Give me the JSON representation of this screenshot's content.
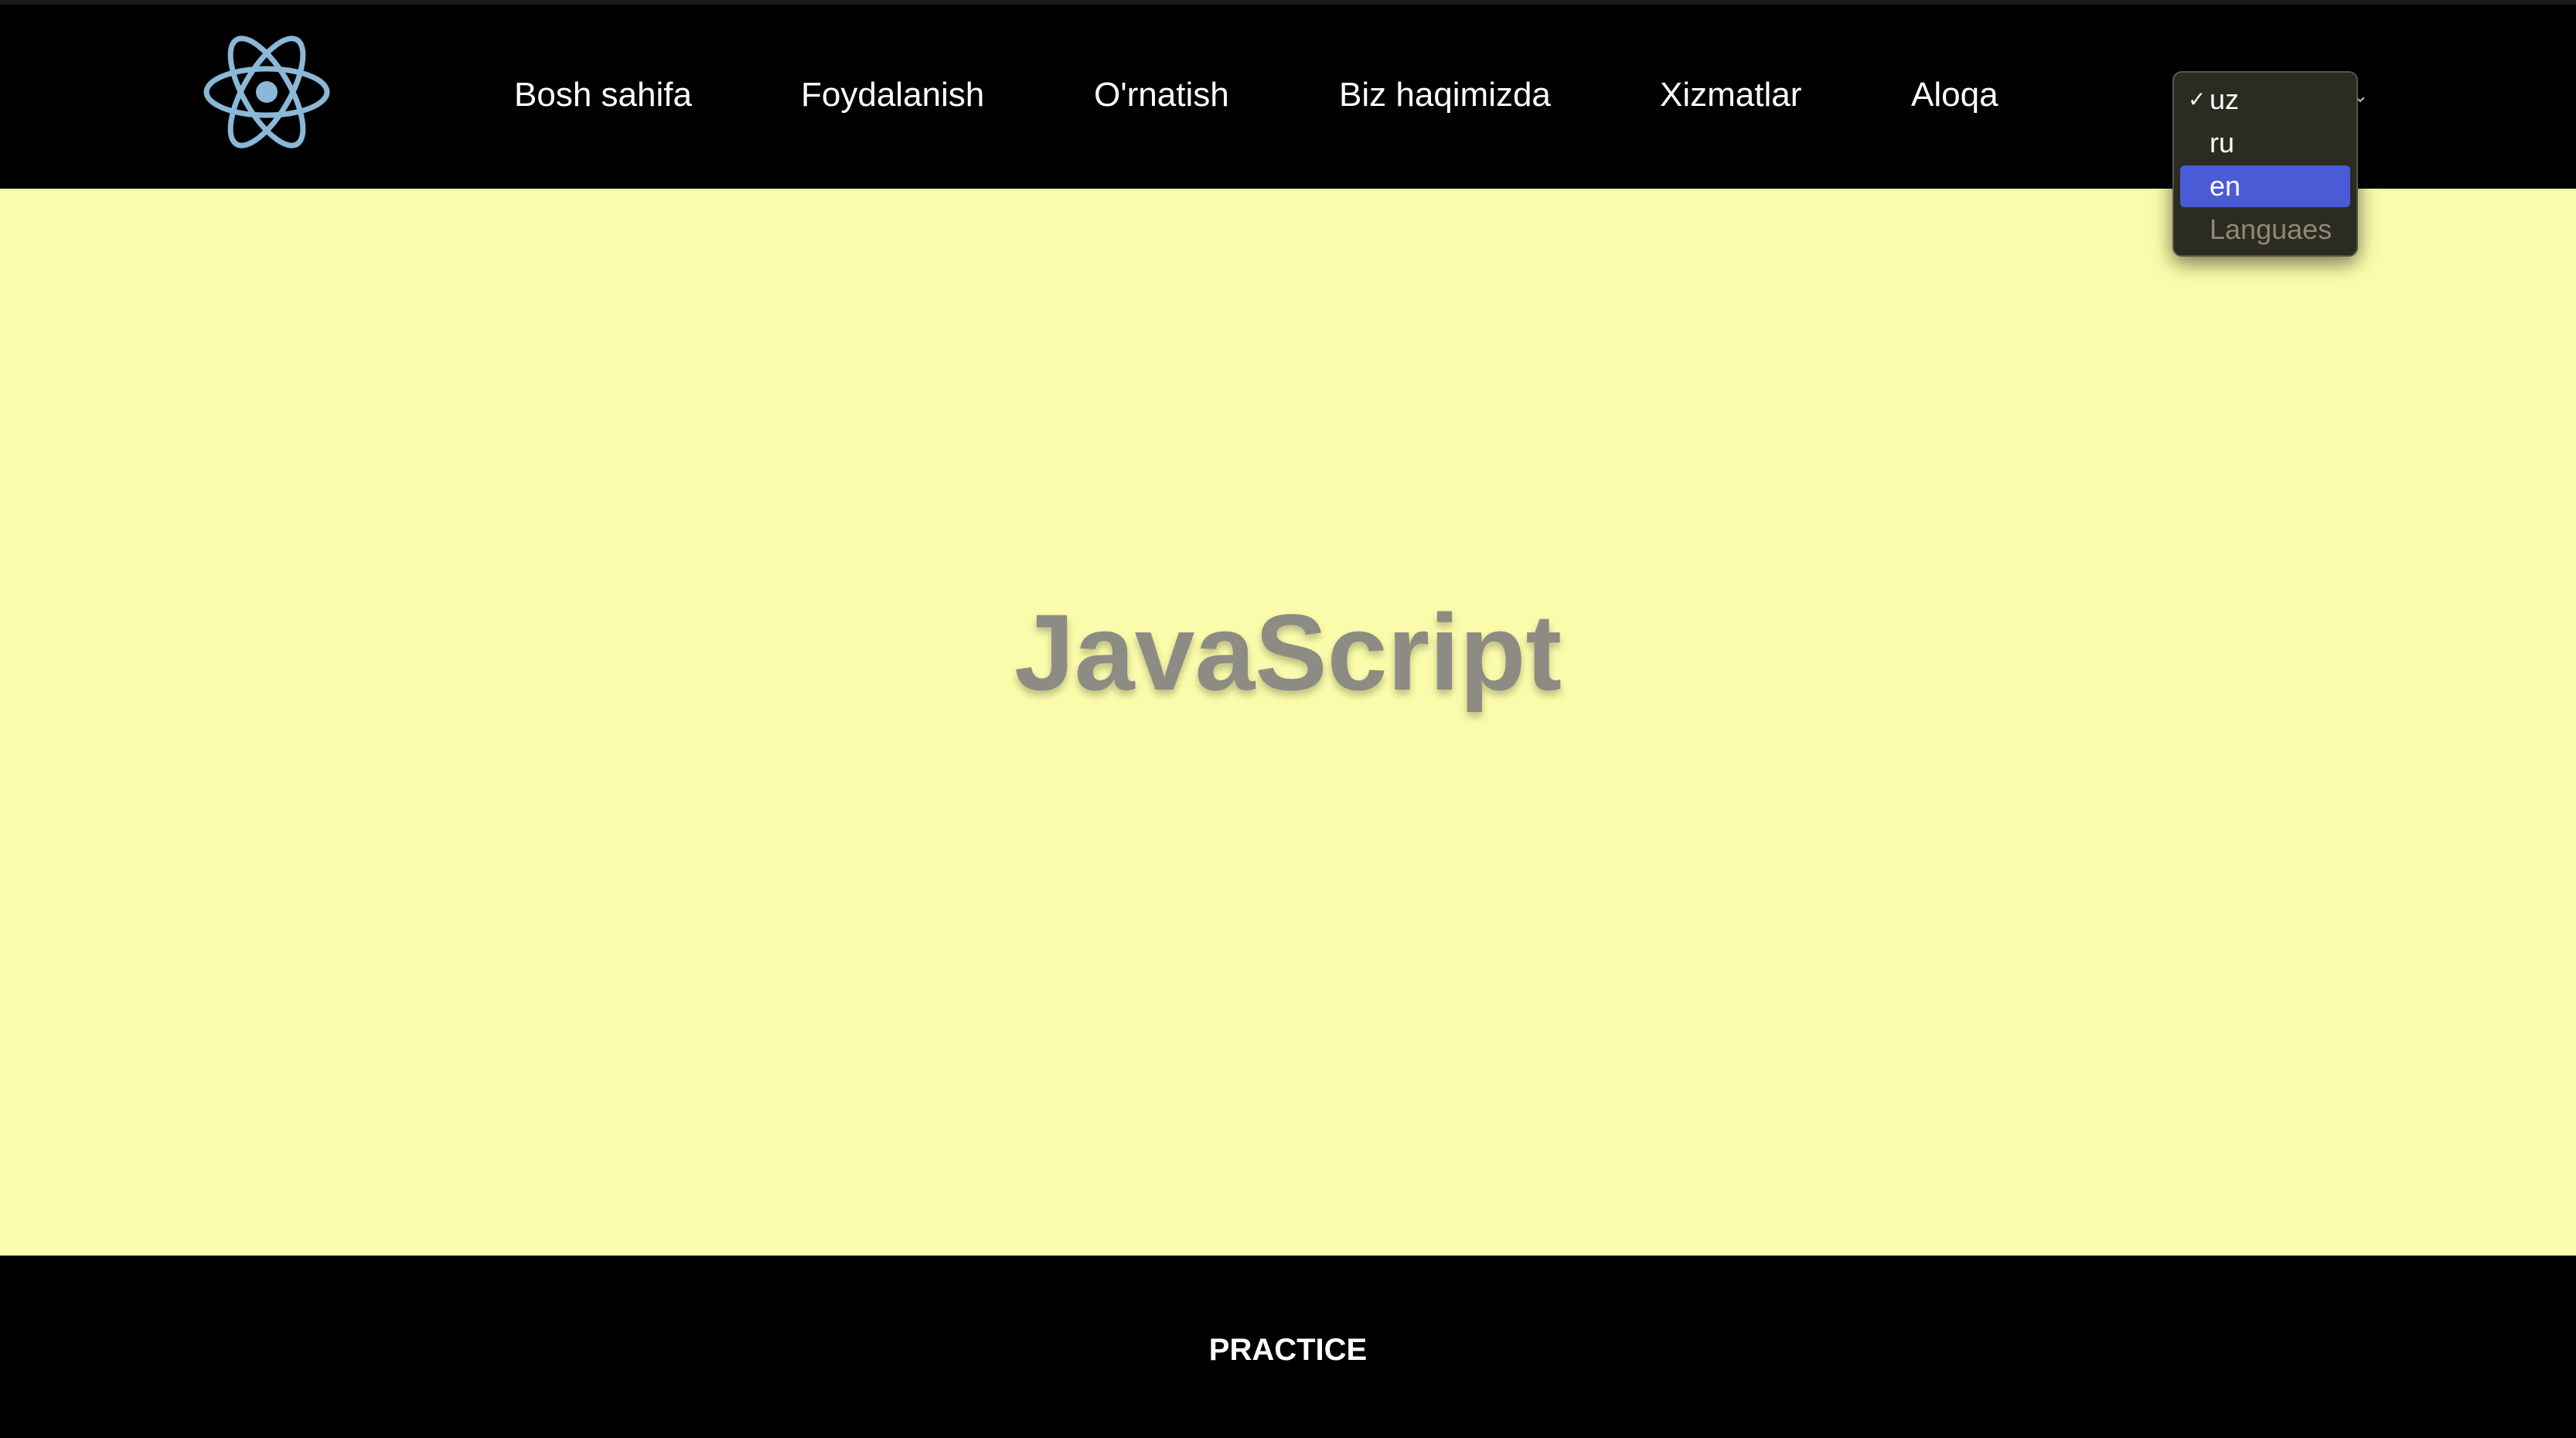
{
  "header": {
    "logo_icon": "react-atom-icon",
    "logo_color": "#8ab8d8",
    "nav": [
      {
        "label": "Bosh sahifa"
      },
      {
        "label": "Foydalanish"
      },
      {
        "label": "O'rnatish"
      },
      {
        "label": "Biz haqimizda"
      },
      {
        "label": "Xizmatlar"
      },
      {
        "label": "Aloqa"
      }
    ]
  },
  "language_select": {
    "selected": "uz",
    "highlighted": "en",
    "options": [
      {
        "label": "uz",
        "checked": true,
        "disabled": false
      },
      {
        "label": "ru",
        "checked": false,
        "disabled": false
      },
      {
        "label": "en",
        "checked": false,
        "disabled": false
      },
      {
        "label": "Languaes",
        "checked": false,
        "disabled": true
      }
    ],
    "check_glyph": "✓"
  },
  "main": {
    "title": "JavaScript",
    "background": "#fbfcab"
  },
  "footer": {
    "text": "PRACTICE"
  }
}
